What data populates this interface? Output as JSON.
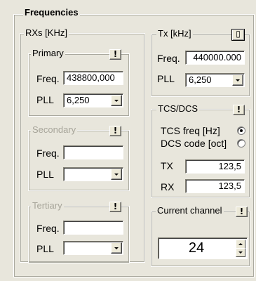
{
  "frequencies": {
    "title": "Frequencies"
  },
  "rxs": {
    "title": "RXs [KHz]",
    "primary": {
      "title": "Primary",
      "freq_label": "Freq.",
      "freq_value": "438800,000",
      "pll_label": "PLL",
      "pll_value": "6,250",
      "info_icon": "info-icon"
    },
    "secondary": {
      "title": "Secondary",
      "freq_label": "Freq.",
      "freq_value": "",
      "pll_label": "PLL",
      "pll_value": "",
      "info_icon": "info-icon"
    },
    "tertiary": {
      "title": "Tertiary",
      "freq_label": "Freq.",
      "freq_value": "",
      "pll_label": "PLL",
      "pll_value": "",
      "info_icon": "info-icon"
    }
  },
  "tx": {
    "title": "Tx [kHz]",
    "freq_label": "Freq.",
    "freq_value": "440000.000",
    "pll_label": "PLL",
    "pll_value": "6,250",
    "doc_icon": "document-icon"
  },
  "tcs_dcs": {
    "title": "TCS/DCS",
    "tcs_label": "TCS freq [Hz]",
    "dcs_label": "DCS code [oct]",
    "selected": "tcs",
    "tx_label": "TX",
    "tx_value": "123,5",
    "rx_label": "RX",
    "rx_value": "123,5",
    "info_icon": "info-icon"
  },
  "current_channel": {
    "title": "Current channel",
    "value": "24",
    "info_icon": "info-icon"
  },
  "icons": {
    "info": "!",
    "doc": "▯"
  },
  "colors": {
    "background": "#e8e6dc",
    "disabled_text": "#a7a59a"
  }
}
